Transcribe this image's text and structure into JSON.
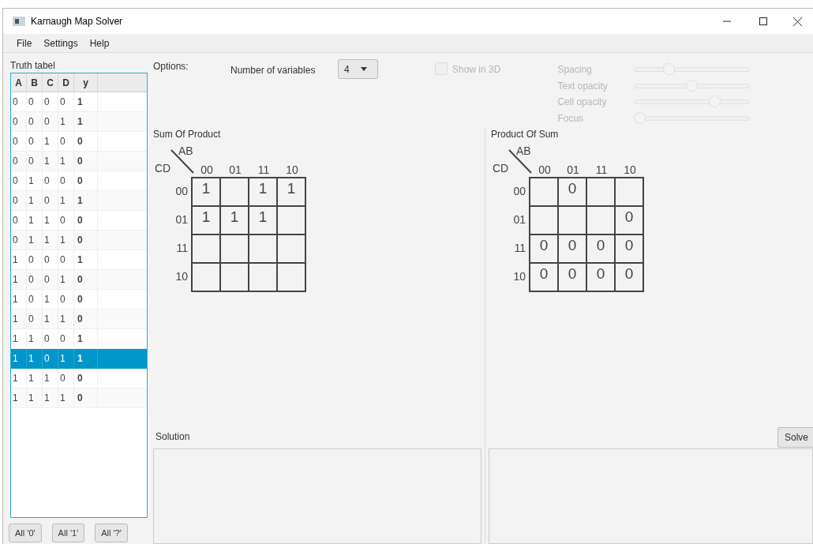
{
  "window": {
    "title": "Karnaugh Map Solver"
  },
  "menu": [
    "File",
    "Settings",
    "Help"
  ],
  "truth_table": {
    "title": "Truth tabel",
    "columns": [
      "A",
      "B",
      "C",
      "D",
      "y"
    ],
    "rows": [
      {
        "cells": [
          "0",
          "0",
          "0",
          "0",
          "1"
        ],
        "selected": false
      },
      {
        "cells": [
          "0",
          "0",
          "0",
          "1",
          "1"
        ],
        "selected": false
      },
      {
        "cells": [
          "0",
          "0",
          "1",
          "0",
          "0"
        ],
        "selected": false
      },
      {
        "cells": [
          "0",
          "0",
          "1",
          "1",
          "0"
        ],
        "selected": false
      },
      {
        "cells": [
          "0",
          "1",
          "0",
          "0",
          "0"
        ],
        "selected": false
      },
      {
        "cells": [
          "0",
          "1",
          "0",
          "1",
          "1"
        ],
        "selected": false
      },
      {
        "cells": [
          "0",
          "1",
          "1",
          "0",
          "0"
        ],
        "selected": false
      },
      {
        "cells": [
          "0",
          "1",
          "1",
          "1",
          "0"
        ],
        "selected": false
      },
      {
        "cells": [
          "1",
          "0",
          "0",
          "0",
          "1"
        ],
        "selected": false
      },
      {
        "cells": [
          "1",
          "0",
          "0",
          "1",
          "0"
        ],
        "selected": false
      },
      {
        "cells": [
          "1",
          "0",
          "1",
          "0",
          "0"
        ],
        "selected": false
      },
      {
        "cells": [
          "1",
          "0",
          "1",
          "1",
          "0"
        ],
        "selected": false
      },
      {
        "cells": [
          "1",
          "1",
          "0",
          "0",
          "1"
        ],
        "selected": false
      },
      {
        "cells": [
          "1",
          "1",
          "0",
          "1",
          "1"
        ],
        "selected": true
      },
      {
        "cells": [
          "1",
          "1",
          "1",
          "0",
          "0"
        ],
        "selected": false
      },
      {
        "cells": [
          "1",
          "1",
          "1",
          "1",
          "0"
        ],
        "selected": false
      }
    ],
    "buttons": [
      "All '0'",
      "All '1'",
      "All '?'"
    ]
  },
  "options": {
    "label": "Options:",
    "variables_label": "Number of variables",
    "variables_value": "4",
    "show_3d": {
      "label": "Show in 3D",
      "checked": false,
      "disabled": true
    },
    "sliders": [
      {
        "label": "Spacing",
        "level": 0.28,
        "disabled": true
      },
      {
        "label": "Text opacity",
        "level": 0.5,
        "disabled": true
      },
      {
        "label": "Cell opacity",
        "level": 0.72,
        "disabled": true
      },
      {
        "label": "Focus",
        "level": 0,
        "disabled": true
      }
    ]
  },
  "maps": [
    {
      "title": "Sum Of Product",
      "row_var": "CD",
      "col_var": "AB",
      "col_labels": [
        "00",
        "01",
        "11",
        "10"
      ],
      "row_labels": [
        "00",
        "01",
        "11",
        "10"
      ],
      "cells": [
        [
          "1",
          null,
          "1",
          "1"
        ],
        [
          "1",
          "1",
          "1",
          null
        ],
        [
          null,
          null,
          null,
          null
        ],
        [
          null,
          null,
          null,
          null
        ]
      ]
    },
    {
      "title": "Product Of Sum",
      "row_var": "CD",
      "col_var": "AB",
      "col_labels": [
        "00",
        "01",
        "11",
        "10"
      ],
      "row_labels": [
        "00",
        "01",
        "11",
        "10"
      ],
      "cells": [
        [
          null,
          "0",
          null,
          null
        ],
        [
          null,
          null,
          null,
          "0"
        ],
        [
          "0",
          "0",
          "0",
          "0"
        ],
        [
          "0",
          "0",
          "0",
          "0"
        ]
      ]
    }
  ],
  "solution": {
    "label": "Solution",
    "button": "Solve"
  }
}
